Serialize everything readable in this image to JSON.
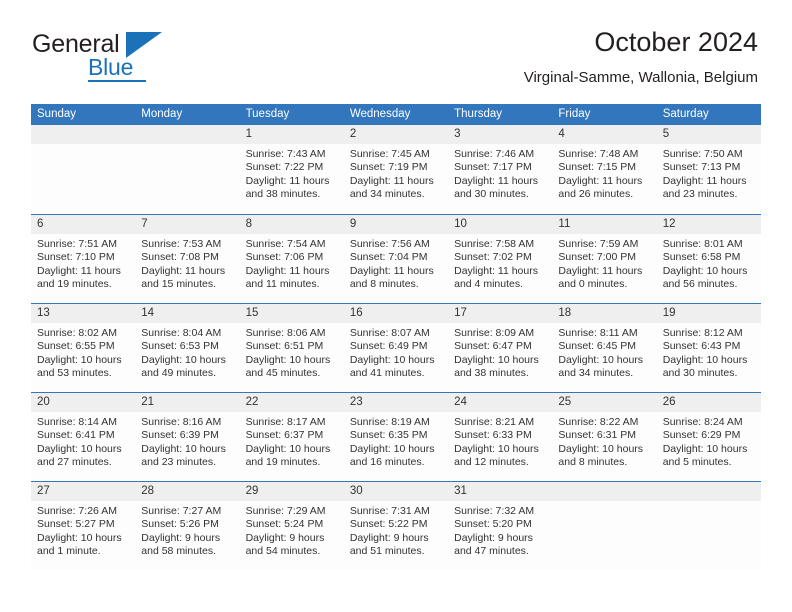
{
  "brand": {
    "word_general": "General",
    "word_blue": "Blue",
    "flag_icon": "triangle-flag-icon",
    "accent_color": "#1b72b8"
  },
  "header": {
    "title": "October 2024",
    "location": "Virginal-Samme, Wallonia, Belgium"
  },
  "theme": {
    "header_blue": "#3276bd",
    "day_band_gray": "#efefef",
    "text_color": "#333333"
  },
  "weekdays": [
    "Sunday",
    "Monday",
    "Tuesday",
    "Wednesday",
    "Thursday",
    "Friday",
    "Saturday"
  ],
  "weeks": [
    [
      {
        "day": "",
        "sunrise": "",
        "sunset": "",
        "daylight": ""
      },
      {
        "day": "",
        "sunrise": "",
        "sunset": "",
        "daylight": ""
      },
      {
        "day": "1",
        "sunrise": "Sunrise: 7:43 AM",
        "sunset": "Sunset: 7:22 PM",
        "daylight": "Daylight: 11 hours and 38 minutes."
      },
      {
        "day": "2",
        "sunrise": "Sunrise: 7:45 AM",
        "sunset": "Sunset: 7:19 PM",
        "daylight": "Daylight: 11 hours and 34 minutes."
      },
      {
        "day": "3",
        "sunrise": "Sunrise: 7:46 AM",
        "sunset": "Sunset: 7:17 PM",
        "daylight": "Daylight: 11 hours and 30 minutes."
      },
      {
        "day": "4",
        "sunrise": "Sunrise: 7:48 AM",
        "sunset": "Sunset: 7:15 PM",
        "daylight": "Daylight: 11 hours and 26 minutes."
      },
      {
        "day": "5",
        "sunrise": "Sunrise: 7:50 AM",
        "sunset": "Sunset: 7:13 PM",
        "daylight": "Daylight: 11 hours and 23 minutes."
      }
    ],
    [
      {
        "day": "6",
        "sunrise": "Sunrise: 7:51 AM",
        "sunset": "Sunset: 7:10 PM",
        "daylight": "Daylight: 11 hours and 19 minutes."
      },
      {
        "day": "7",
        "sunrise": "Sunrise: 7:53 AM",
        "sunset": "Sunset: 7:08 PM",
        "daylight": "Daylight: 11 hours and 15 minutes."
      },
      {
        "day": "8",
        "sunrise": "Sunrise: 7:54 AM",
        "sunset": "Sunset: 7:06 PM",
        "daylight": "Daylight: 11 hours and 11 minutes."
      },
      {
        "day": "9",
        "sunrise": "Sunrise: 7:56 AM",
        "sunset": "Sunset: 7:04 PM",
        "daylight": "Daylight: 11 hours and 8 minutes."
      },
      {
        "day": "10",
        "sunrise": "Sunrise: 7:58 AM",
        "sunset": "Sunset: 7:02 PM",
        "daylight": "Daylight: 11 hours and 4 minutes."
      },
      {
        "day": "11",
        "sunrise": "Sunrise: 7:59 AM",
        "sunset": "Sunset: 7:00 PM",
        "daylight": "Daylight: 11 hours and 0 minutes."
      },
      {
        "day": "12",
        "sunrise": "Sunrise: 8:01 AM",
        "sunset": "Sunset: 6:58 PM",
        "daylight": "Daylight: 10 hours and 56 minutes."
      }
    ],
    [
      {
        "day": "13",
        "sunrise": "Sunrise: 8:02 AM",
        "sunset": "Sunset: 6:55 PM",
        "daylight": "Daylight: 10 hours and 53 minutes."
      },
      {
        "day": "14",
        "sunrise": "Sunrise: 8:04 AM",
        "sunset": "Sunset: 6:53 PM",
        "daylight": "Daylight: 10 hours and 49 minutes."
      },
      {
        "day": "15",
        "sunrise": "Sunrise: 8:06 AM",
        "sunset": "Sunset: 6:51 PM",
        "daylight": "Daylight: 10 hours and 45 minutes."
      },
      {
        "day": "16",
        "sunrise": "Sunrise: 8:07 AM",
        "sunset": "Sunset: 6:49 PM",
        "daylight": "Daylight: 10 hours and 41 minutes."
      },
      {
        "day": "17",
        "sunrise": "Sunrise: 8:09 AM",
        "sunset": "Sunset: 6:47 PM",
        "daylight": "Daylight: 10 hours and 38 minutes."
      },
      {
        "day": "18",
        "sunrise": "Sunrise: 8:11 AM",
        "sunset": "Sunset: 6:45 PM",
        "daylight": "Daylight: 10 hours and 34 minutes."
      },
      {
        "day": "19",
        "sunrise": "Sunrise: 8:12 AM",
        "sunset": "Sunset: 6:43 PM",
        "daylight": "Daylight: 10 hours and 30 minutes."
      }
    ],
    [
      {
        "day": "20",
        "sunrise": "Sunrise: 8:14 AM",
        "sunset": "Sunset: 6:41 PM",
        "daylight": "Daylight: 10 hours and 27 minutes."
      },
      {
        "day": "21",
        "sunrise": "Sunrise: 8:16 AM",
        "sunset": "Sunset: 6:39 PM",
        "daylight": "Daylight: 10 hours and 23 minutes."
      },
      {
        "day": "22",
        "sunrise": "Sunrise: 8:17 AM",
        "sunset": "Sunset: 6:37 PM",
        "daylight": "Daylight: 10 hours and 19 minutes."
      },
      {
        "day": "23",
        "sunrise": "Sunrise: 8:19 AM",
        "sunset": "Sunset: 6:35 PM",
        "daylight": "Daylight: 10 hours and 16 minutes."
      },
      {
        "day": "24",
        "sunrise": "Sunrise: 8:21 AM",
        "sunset": "Sunset: 6:33 PM",
        "daylight": "Daylight: 10 hours and 12 minutes."
      },
      {
        "day": "25",
        "sunrise": "Sunrise: 8:22 AM",
        "sunset": "Sunset: 6:31 PM",
        "daylight": "Daylight: 10 hours and 8 minutes."
      },
      {
        "day": "26",
        "sunrise": "Sunrise: 8:24 AM",
        "sunset": "Sunset: 6:29 PM",
        "daylight": "Daylight: 10 hours and 5 minutes."
      }
    ],
    [
      {
        "day": "27",
        "sunrise": "Sunrise: 7:26 AM",
        "sunset": "Sunset: 5:27 PM",
        "daylight": "Daylight: 10 hours and 1 minute."
      },
      {
        "day": "28",
        "sunrise": "Sunrise: 7:27 AM",
        "sunset": "Sunset: 5:26 PM",
        "daylight": "Daylight: 9 hours and 58 minutes."
      },
      {
        "day": "29",
        "sunrise": "Sunrise: 7:29 AM",
        "sunset": "Sunset: 5:24 PM",
        "daylight": "Daylight: 9 hours and 54 minutes."
      },
      {
        "day": "30",
        "sunrise": "Sunrise: 7:31 AM",
        "sunset": "Sunset: 5:22 PM",
        "daylight": "Daylight: 9 hours and 51 minutes."
      },
      {
        "day": "31",
        "sunrise": "Sunrise: 7:32 AM",
        "sunset": "Sunset: 5:20 PM",
        "daylight": "Daylight: 9 hours and 47 minutes."
      },
      {
        "day": "",
        "sunrise": "",
        "sunset": "",
        "daylight": ""
      },
      {
        "day": "",
        "sunrise": "",
        "sunset": "",
        "daylight": ""
      }
    ]
  ]
}
